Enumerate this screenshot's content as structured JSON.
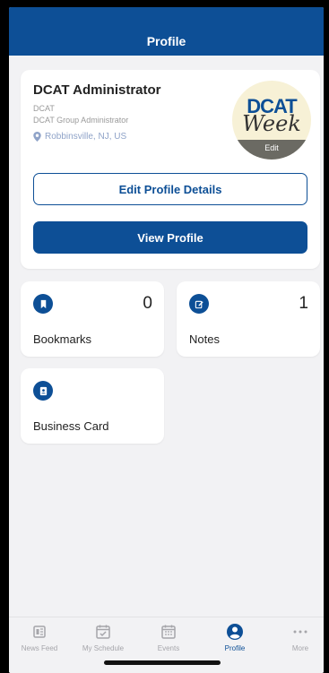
{
  "header": {
    "title": "Profile"
  },
  "profile": {
    "name": "DCAT Administrator",
    "org": "DCAT",
    "role": "DCAT Group Administrator",
    "location": "Robbinsville, NJ, US",
    "logo_top": "DCAT",
    "logo_bottom": "Week",
    "logo_edit": "Edit",
    "edit_button": "Edit Profile Details",
    "view_button": "View Profile"
  },
  "tiles": {
    "bookmarks": {
      "label": "Bookmarks",
      "count": "0",
      "icon": "bookmark-icon"
    },
    "notes": {
      "label": "Notes",
      "count": "1",
      "icon": "edit-note-icon"
    },
    "business_card": {
      "label": "Business Card",
      "icon": "business-card-icon"
    }
  },
  "tabbar": {
    "items": [
      {
        "label": "News Feed",
        "icon": "news-feed-icon"
      },
      {
        "label": "My Schedule",
        "icon": "calendar-check-icon"
      },
      {
        "label": "Events",
        "icon": "calendar-grid-icon"
      },
      {
        "label": "Profile",
        "icon": "person-icon",
        "active": true
      },
      {
        "label": "More",
        "icon": "more-dots-icon"
      }
    ]
  },
  "colors": {
    "brand": "#0d4f96",
    "background": "#f2f2f4",
    "inactive": "#a5a5aa"
  }
}
